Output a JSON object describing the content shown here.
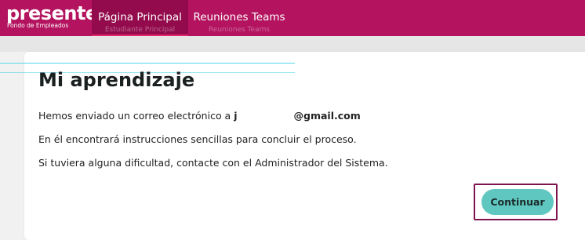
{
  "brand": {
    "name": "presente",
    "tagline": "Fondo de Empleados",
    "color": "#b3135f"
  },
  "nav": {
    "items": [
      {
        "label": "Página Principal",
        "ghost": "Estudiante Principal",
        "active": true
      },
      {
        "label": "Reuniones Teams",
        "ghost": "Reuniones Teams",
        "active": false
      }
    ]
  },
  "main": {
    "title": "Mi aprendizaje",
    "email_prefix": "Hemos enviado un correo electrónico a ",
    "email_start": "j",
    "email_domain": "@gmail.com",
    "line2": "En él encontrará instrucciones sencillas para concluir el proceso.",
    "line3": "Si tuviera alguna dificultad, contacte con el Administrador del Sistema."
  },
  "actions": {
    "continue_label": "Continuar",
    "button_color": "#5fc7bf"
  }
}
